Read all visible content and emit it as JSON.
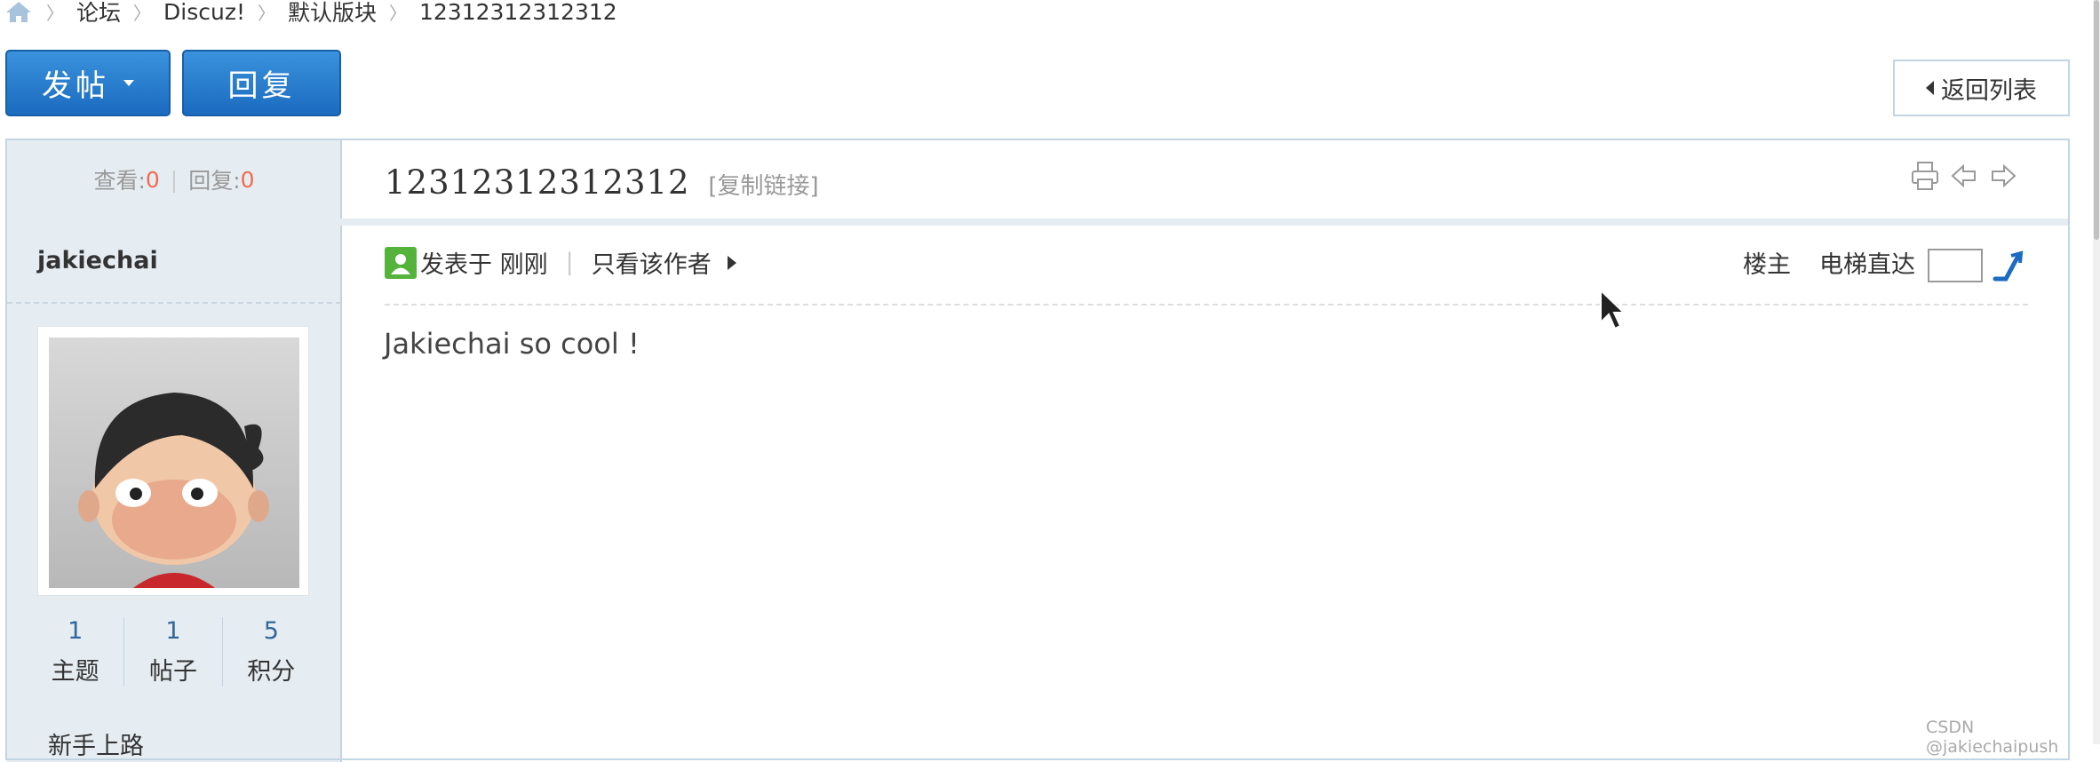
{
  "breadcrumb": {
    "home_icon": "home-icon",
    "items": [
      "论坛",
      "Discuz!",
      "默认版块",
      "12312312312312"
    ]
  },
  "toolbar": {
    "post_label": "发帖",
    "reply_label": "回复",
    "back_label": "返回列表"
  },
  "stats": {
    "views_label": "查看:",
    "views_value": "0",
    "replies_label": "回复:",
    "replies_value": "0"
  },
  "thread": {
    "title": "12312312312312",
    "copy_link": "[复制链接]"
  },
  "post": {
    "author": "jakiechai",
    "posted_label": "发表于 刚刚",
    "only_author_label": "只看该作者",
    "floor_label": "楼主",
    "elevator_label": "电梯直达",
    "elevator_value": "",
    "content": "Jakiechai so cool !"
  },
  "user_stats": [
    {
      "value": "1",
      "label": "主题"
    },
    {
      "value": "1",
      "label": "帖子"
    },
    {
      "value": "5",
      "label": "积分"
    }
  ],
  "user_group": "新手上路",
  "watermark": "CSDN @jakiechaipush",
  "colors": {
    "accent_blue": "#1b6bc0",
    "number_orange": "#f26c4f",
    "sidebar_bg": "#e5edf2",
    "border": "#c2d5e3"
  }
}
